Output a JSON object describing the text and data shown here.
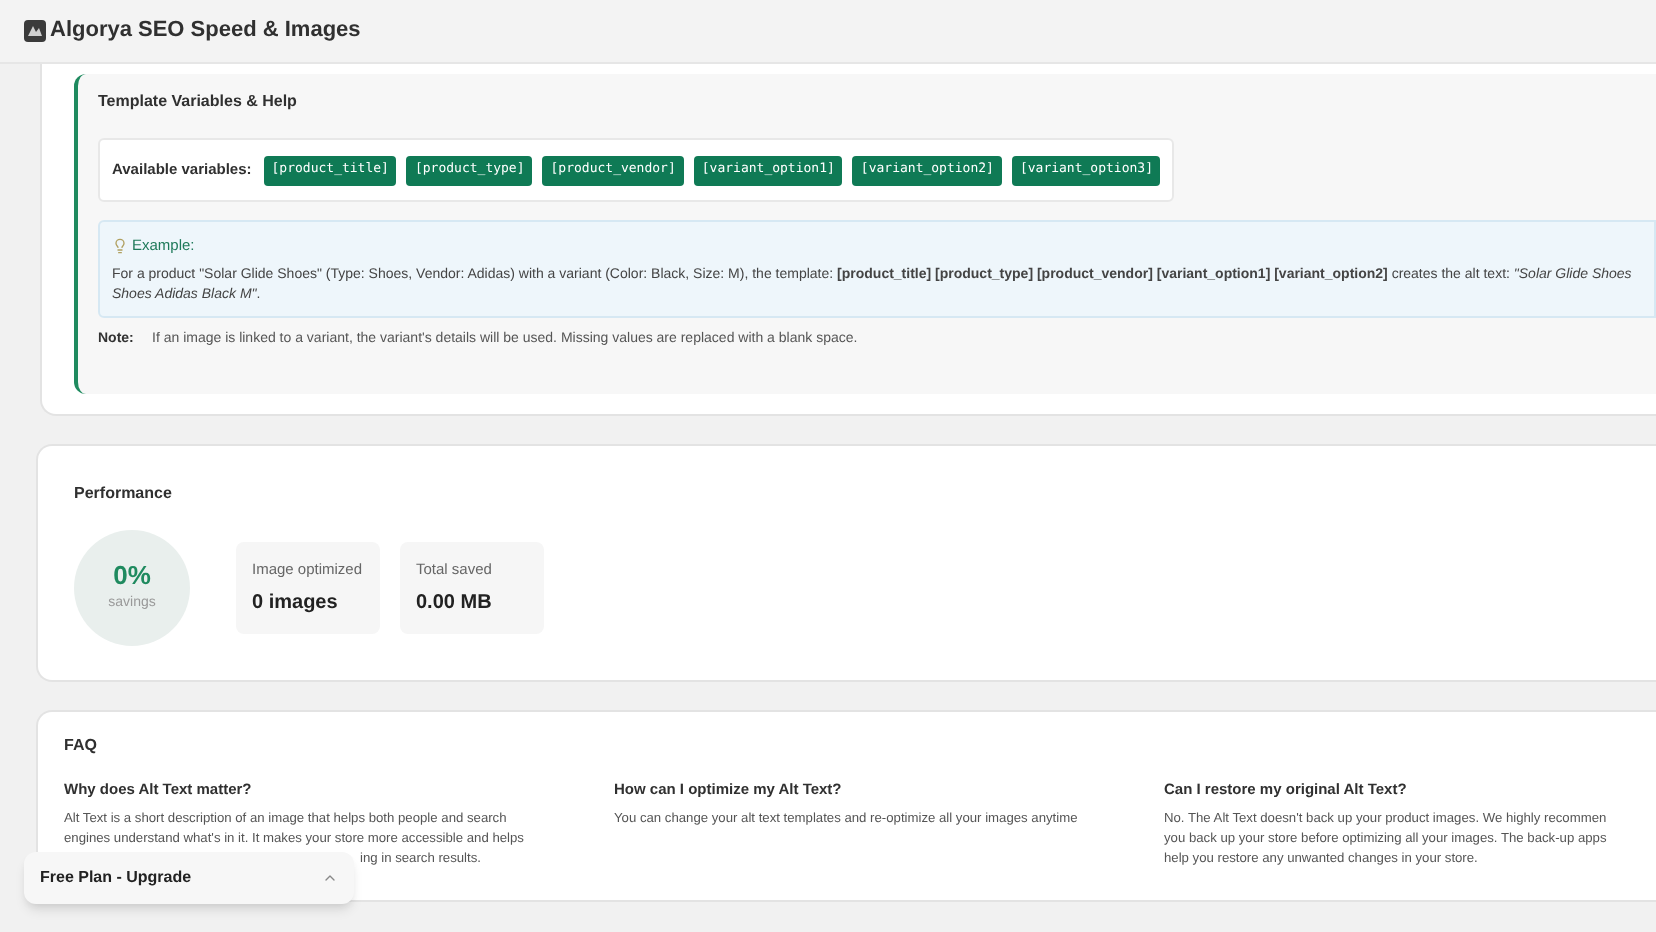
{
  "app": {
    "title": "Algorya SEO Speed & Images"
  },
  "template_help": {
    "title": "Template Variables & Help",
    "variables_label": "Available variables:",
    "variables": [
      "[product_title]",
      "[product_type]",
      "[product_vendor]",
      "[variant_option1]",
      "[variant_option2]",
      "[variant_option3]"
    ],
    "example": {
      "title": "Example:",
      "text": "For a product \"Solar Glide Shoes\" (Type: Shoes, Vendor: Adidas) with a variant (Color: Black, Size: M), the template: **[product_title] [product_type] [product_vendor] [variant_option1] [variant_option2]** creates the alt text: *\"Solar Glide Shoes Shoes Adidas Black M\"*."
    },
    "note": {
      "label": "Note:",
      "text": "If an image is linked to a variant, the variant's details will be used. Missing values are replaced with a blank space."
    }
  },
  "performance": {
    "title": "Performance",
    "savings": {
      "value": "0%",
      "label": "savings"
    },
    "stats": [
      {
        "label": "Image optimized",
        "value": "0 images"
      },
      {
        "label": "Total saved",
        "value": "0.00 MB"
      }
    ]
  },
  "faq": {
    "title": "FAQ",
    "items": [
      {
        "question": "Why does Alt Text matter?",
        "answer_lines": [
          "Alt Text is a short description of an image that helps both people and search",
          "engines understand what's in it. It makes your store more accessible and helps"
        ],
        "answer_tail": "ing in search results."
      },
      {
        "question": "How can I optimize my Alt Text?",
        "answer_lines": [
          "You can change your alt text templates and re-optimize all your images anytime"
        ]
      },
      {
        "question": "Can I restore my original Alt Text?",
        "answer_lines": [
          "No. The Alt Text doesn't back up your product images. We highly recommen",
          "you back up your store before optimizing all your images. The back-up apps",
          "help you restore any unwanted changes in your store."
        ]
      }
    ]
  },
  "plan_banner": {
    "label": "Free Plan - Upgrade"
  }
}
